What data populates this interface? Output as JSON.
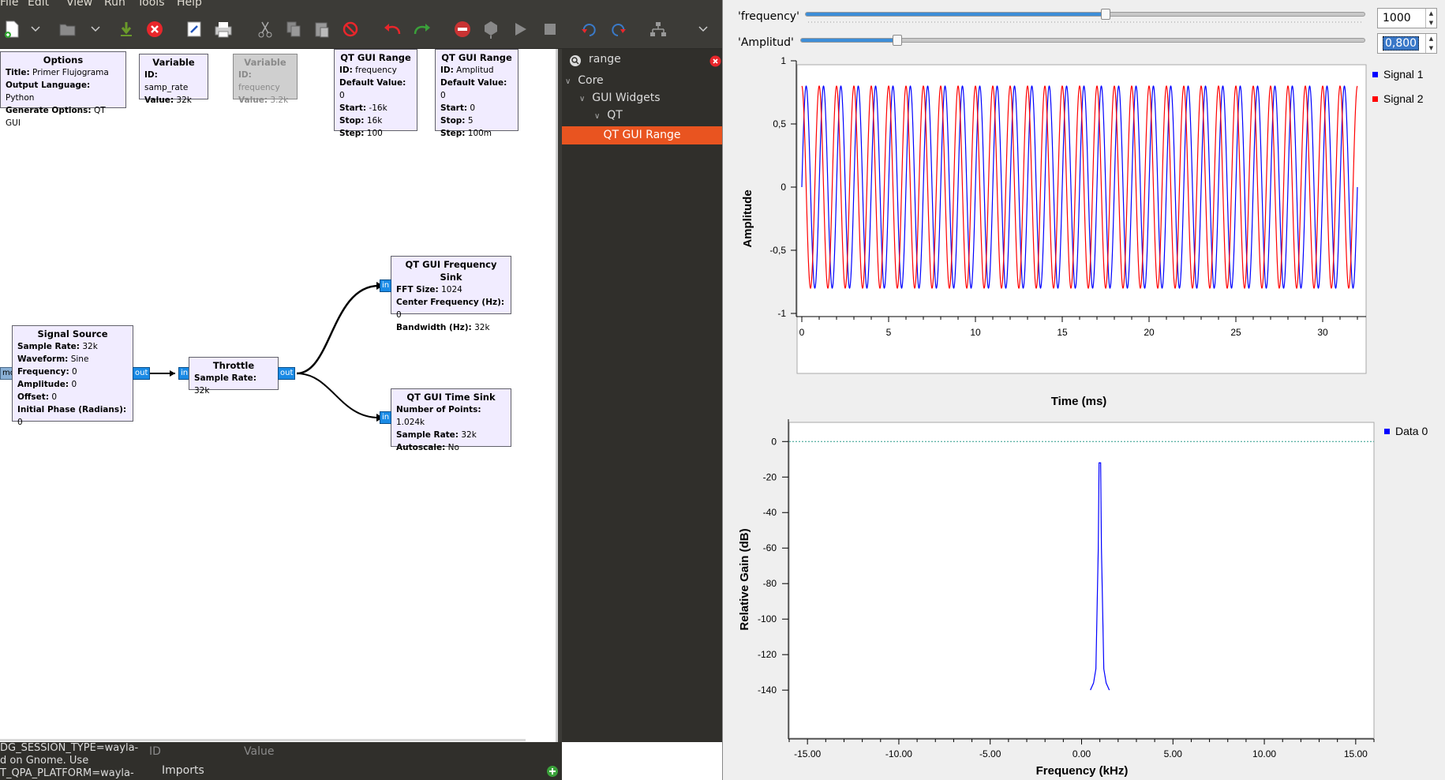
{
  "menu": [
    "File",
    "Edit",
    "View",
    "Run",
    "Tools",
    "Help"
  ],
  "blocks": {
    "options": {
      "title": "Options",
      "rows": [
        [
          "Title:",
          "Primer Flujograma"
        ],
        [
          "Output Language:",
          "Python"
        ],
        [
          "Generate Options:",
          "QT GUI"
        ]
      ]
    },
    "variable1": {
      "title": "Variable",
      "rows": [
        [
          "ID:",
          "samp_rate"
        ],
        [
          "Value:",
          "32k"
        ]
      ]
    },
    "variable2": {
      "title": "Variable",
      "rows": [
        [
          "ID:",
          "frequency"
        ],
        [
          "Value:",
          "3.2k"
        ]
      ]
    },
    "range1": {
      "title": "QT GUI Range",
      "rows": [
        [
          "ID:",
          "frequency"
        ],
        [
          "Default Value:",
          "0"
        ],
        [
          "Start:",
          "-16k"
        ],
        [
          "Stop:",
          "16k"
        ],
        [
          "Step:",
          "100"
        ]
      ]
    },
    "range2": {
      "title": "QT GUI Range",
      "rows": [
        [
          "ID:",
          "Amplitud"
        ],
        [
          "Default Value:",
          "0"
        ],
        [
          "Start:",
          "0"
        ],
        [
          "Stop:",
          "5"
        ],
        [
          "Step:",
          "100m"
        ]
      ]
    },
    "freqsink": {
      "title": "QT GUI Frequency Sink",
      "rows": [
        [
          "FFT Size:",
          "1024"
        ],
        [
          "Center Frequency (Hz):",
          "0"
        ],
        [
          "Bandwidth (Hz):",
          "32k"
        ]
      ]
    },
    "timesink": {
      "title": "QT GUI Time Sink",
      "rows": [
        [
          "Number of Points:",
          "1.024k"
        ],
        [
          "Sample Rate:",
          "32k"
        ],
        [
          "Autoscale:",
          "No"
        ]
      ]
    },
    "source": {
      "title": "Signal Source",
      "rows": [
        [
          "Sample Rate:",
          "32k"
        ],
        [
          "Waveform:",
          "Sine"
        ],
        [
          "Frequency:",
          "0"
        ],
        [
          "Amplitude:",
          "0"
        ],
        [
          "Offset:",
          "0"
        ],
        [
          "Initial Phase (Radians):",
          "0"
        ]
      ]
    },
    "throttle": {
      "title": "Throttle",
      "rows": [
        [
          "Sample Rate:",
          "32k"
        ]
      ]
    }
  },
  "ports": {
    "in": "in",
    "out": "out",
    "cmd": "md"
  },
  "library": {
    "search": "range",
    "tree": [
      "Core",
      "GUI Widgets",
      "QT",
      "QT GUI Range"
    ]
  },
  "console": {
    "lines": [
      "DG_SESSION_TYPE=wayla-",
      "d on Gnome. Use",
      "T_QPA_PLATFORM=wayla-"
    ]
  },
  "variables": {
    "col_id": "ID",
    "col_value": "Value",
    "row1": "Imports"
  },
  "qt": {
    "freq_label": "'frequency'",
    "freq_value": "1000",
    "amp_label": "'Amplitud'",
    "amp_value": "0,800",
    "time_plot": {
      "ylabel": "Amplitude",
      "xlabel": "Time (ms)",
      "yticks": [
        "1",
        "0,5",
        "0",
        "-0,5",
        "-1"
      ],
      "xticks": [
        "0",
        "5",
        "10",
        "15",
        "20",
        "25",
        "30"
      ],
      "legend": [
        "Signal 1",
        "Signal 2"
      ]
    },
    "freq_plot": {
      "ylabel": "Relative Gain (dB)",
      "xlabel": "Frequency (kHz)",
      "yticks": [
        "0",
        "-20",
        "-40",
        "-60",
        "-80",
        "-100",
        "-120",
        "-140"
      ],
      "xticks": [
        "-15.00",
        "-10.00",
        "-5.00",
        "0.00",
        "5.00",
        "10.00",
        "15.00"
      ],
      "legend": [
        "Data 0"
      ]
    }
  },
  "chart_data": [
    {
      "type": "line",
      "ylabel": "Amplitude",
      "xlabel": "Time (ms)",
      "xlim": [
        0,
        32
      ],
      "ylim": [
        -1,
        1
      ],
      "series": [
        {
          "name": "Signal 1",
          "color": "#0000ff",
          "frequency_khz": 1.0,
          "amplitude": 0.8,
          "phase": 0
        },
        {
          "name": "Signal 2",
          "color": "#ff0000",
          "frequency_khz": 1.0,
          "amplitude": 0.8,
          "phase": 1.57
        }
      ]
    },
    {
      "type": "line",
      "ylabel": "Relative Gain (dB)",
      "xlabel": "Frequency (kHz)",
      "xlim": [
        -16,
        16
      ],
      "ylim": [
        -140,
        10
      ],
      "series": [
        {
          "name": "Data 0",
          "color": "#0000ff",
          "peak_khz": 1.0,
          "peak_db": -12,
          "floor_db": -140
        }
      ]
    }
  ],
  "colors": {
    "accent": "#e95420",
    "port": "#1a8ae5",
    "block_bg": "#f1ecff",
    "signal1": "#0000ff",
    "signal2": "#ff0000"
  }
}
